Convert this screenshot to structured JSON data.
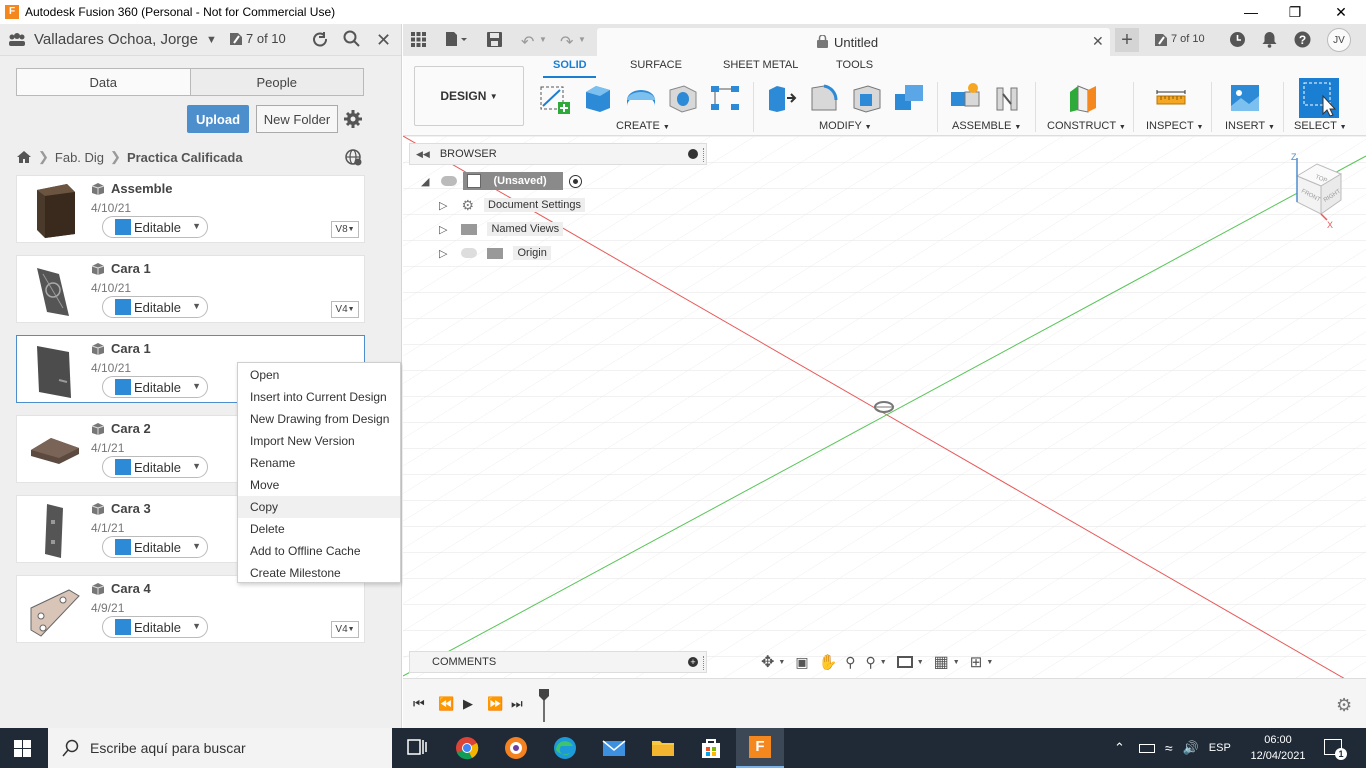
{
  "window": {
    "title": "Autodesk Fusion 360 (Personal - Not for Commercial Use)",
    "logo_letter": "F"
  },
  "data_panel": {
    "user": "Valladares Ochoa, Jorge",
    "job_count": "7 of 10",
    "tabs": [
      "Data",
      "People"
    ],
    "upload_label": "Upload",
    "new_folder_label": "New Folder",
    "breadcrumb": [
      "Fab. Dig",
      "Practica Calificada"
    ],
    "items": [
      {
        "name": "Assemble",
        "date": "4/10/21",
        "status": "Editable",
        "version": "V8"
      },
      {
        "name": "Cara 1",
        "date": "4/10/21",
        "status": "Editable",
        "version": "V4"
      },
      {
        "name": "Cara 1",
        "date": "4/10/21",
        "status": "Editable",
        "version": ""
      },
      {
        "name": "Cara 2",
        "date": "4/1/21",
        "status": "Editable",
        "version": ""
      },
      {
        "name": "Cara 3",
        "date": "4/1/21",
        "status": "Editable",
        "version": ""
      },
      {
        "name": "Cara 4",
        "date": "4/9/21",
        "status": "Editable",
        "version": "V4"
      }
    ]
  },
  "context_menu": {
    "items": [
      "Open",
      "Insert into Current Design",
      "New Drawing from Design",
      "Import New Version",
      "Rename",
      "Move",
      "Copy",
      "Delete",
      "Add to Offline Cache",
      "Create Milestone"
    ],
    "hovered": "Copy"
  },
  "design": {
    "doc_title": "Untitled",
    "job_count": "7 of 10",
    "user_initials": "JV",
    "workspace": "DESIGN",
    "ribbon_tabs": [
      "SOLID",
      "SURFACE",
      "SHEET METAL",
      "TOOLS"
    ],
    "groups": [
      "CREATE",
      "MODIFY",
      "ASSEMBLE",
      "CONSTRUCT",
      "INSPECT",
      "INSERT",
      "SELECT"
    ],
    "browser_title": "BROWSER",
    "tree": {
      "root": "(Unsaved)",
      "children": [
        "Document Settings",
        "Named Views",
        "Origin"
      ]
    },
    "comments_title": "COMMENTS",
    "viewcube": {
      "top": "TOP",
      "front": "FRONT",
      "right": "RIGHT",
      "z": "Z",
      "x": "X"
    }
  },
  "taskbar": {
    "search_placeholder": "Escribe aquí para buscar",
    "language": "ESP",
    "time": "06:00",
    "date": "12/04/2021",
    "notifications": "1"
  },
  "colors": {
    "accent_blue": "#1a7ed2",
    "upload_blue": "#4d8ecd",
    "taskbar": "#1f2a36",
    "axis_red": "#e85a5a",
    "axis_green": "#58c558"
  }
}
